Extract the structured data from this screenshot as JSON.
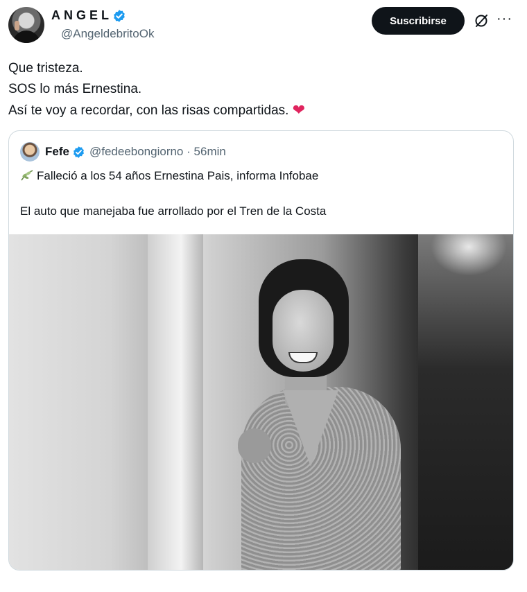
{
  "author": {
    "display_name": "ANGEL",
    "handle": "@AngeldebritoOk",
    "verified": true
  },
  "actions": {
    "subscribe_label": "Suscribirse",
    "grok_icon": "grok-slash-icon",
    "more_label": "···"
  },
  "tweet": {
    "lines": [
      "Que tristeza.",
      "SOS lo más Ernestina.",
      "Así te voy a recordar, con las risas compartidas."
    ],
    "emoji": "❤"
  },
  "quote": {
    "name": "Fefe",
    "handle": "@fedeebongiorno",
    "separator": "·",
    "time": "56min",
    "line1": "Falleció a los 54 años Ernestina Pais, informa Infobae",
    "line2": "El auto que manejaba fue arrollado por el Tren de la Costa",
    "leaf_icon": "leaf-icon"
  },
  "colors": {
    "verified": "#1d9bf0",
    "button_bg": "#0f1419",
    "heart": "#e0245e",
    "secondary_text": "#536471"
  }
}
